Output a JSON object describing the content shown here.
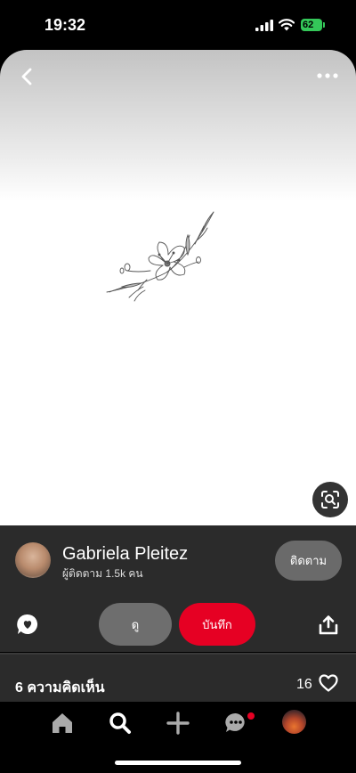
{
  "status_bar": {
    "time": "19:32",
    "battery": "62"
  },
  "pin": {
    "image_description_icon": "flower-tattoo-sketch",
    "back_icon": "chevron-left-icon",
    "more_icon": "more-horizontal-icon",
    "lens_icon": "visual-search-icon"
  },
  "creator": {
    "name": "Gabriela Pleitez",
    "followers": "ผู้ติดตาม 1.5k คน",
    "follow_label": "ติดตาม"
  },
  "actions": {
    "view_label": "ดู",
    "save_label": "บันทึก"
  },
  "comments": {
    "label": "6 ความคิดเห็น",
    "likes": "16"
  },
  "colors": {
    "accent": "#e60023",
    "panel": "#2b2b2b",
    "battery": "#34c759"
  }
}
